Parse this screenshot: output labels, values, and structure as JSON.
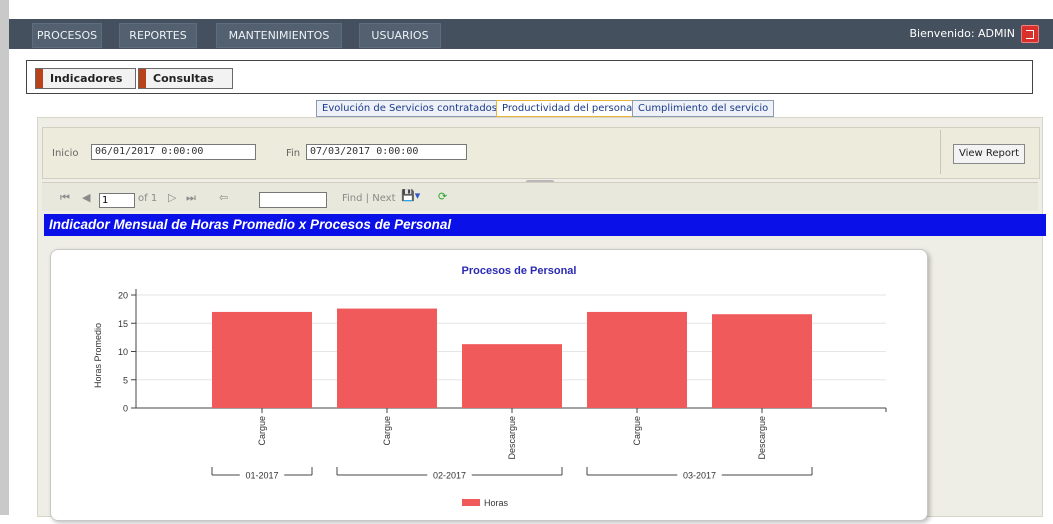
{
  "nav": {
    "items": [
      "PROCESOS",
      "REPORTES",
      "MANTENIMIENTOS",
      "USUARIOS"
    ],
    "welcome": "Bienvenido: ADMIN"
  },
  "main_tabs": [
    "Indicadores",
    "Consultas"
  ],
  "sub_tabs": [
    "Evolución de Servicios contratados",
    "Productividad del personal",
    "Cumplimiento del servicio"
  ],
  "params": {
    "inicio_label": "Inicio",
    "inicio_value": "06/01/2017 0:00:00",
    "fin_label": "Fin",
    "fin_value": "07/03/2017 0:00:00",
    "view_report": "View Report"
  },
  "toolbar": {
    "page": "1",
    "of_pages": "of 1",
    "find_next": "Find | Next"
  },
  "report_title": "Indicador Mensual de Horas Promedio x Procesos de Personal",
  "chart_data": {
    "type": "bar",
    "title": "Procesos de Personal",
    "ylabel": "Horas Promedio",
    "xlabel": "",
    "ylim": [
      0,
      20
    ],
    "yticks": [
      "0",
      "5",
      "10",
      "15",
      "20"
    ],
    "categories": [
      "Cargue",
      "Cargue",
      "Descargue",
      "Cargue",
      "Descargue"
    ],
    "groups": [
      {
        "label": "01-2017",
        "count": 1
      },
      {
        "label": "02-2017",
        "count": 2
      },
      {
        "label": "03-2017",
        "count": 2
      }
    ],
    "series": [
      {
        "name": "Horas",
        "values": [
          17.0,
          17.6,
          11.3,
          17.0,
          16.6
        ]
      }
    ],
    "grid": true,
    "legend_position": "bottom",
    "color": "#f05a5a"
  }
}
